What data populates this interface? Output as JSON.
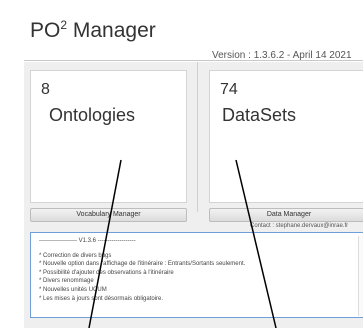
{
  "app": {
    "title_main": "PO",
    "title_sup": "2",
    "title_rest": " Manager",
    "version": "Version : 1.3.6.2 - April 14 2021"
  },
  "cards": {
    "ontologies": {
      "count": "8",
      "label": "Ontologies"
    },
    "datasets": {
      "count": "74",
      "label": "DataSets"
    }
  },
  "buttons": {
    "vocabulary": "Vocabulary Manager",
    "data": "Data Manager"
  },
  "contact": "Contact : stephane.dervaux@inrae.fr",
  "changelog": {
    "heading": "------------------- V1.3.6 -------------------",
    "lines": [
      "* Correction de divers bugs",
      "* Nouvelle option dans l'affichage de l'itinéraire : Entrants/Sortants seulement.",
      "* Possibilité d'ajouter des observations à l'itinéraire",
      "* Divers renommage",
      "* Nouvelles unités UCUM",
      "* Les mises à jours sont désormais obligatoire."
    ]
  },
  "colors": {
    "log_border": "#6f9fd8",
    "panel_bg": "#efefef"
  }
}
